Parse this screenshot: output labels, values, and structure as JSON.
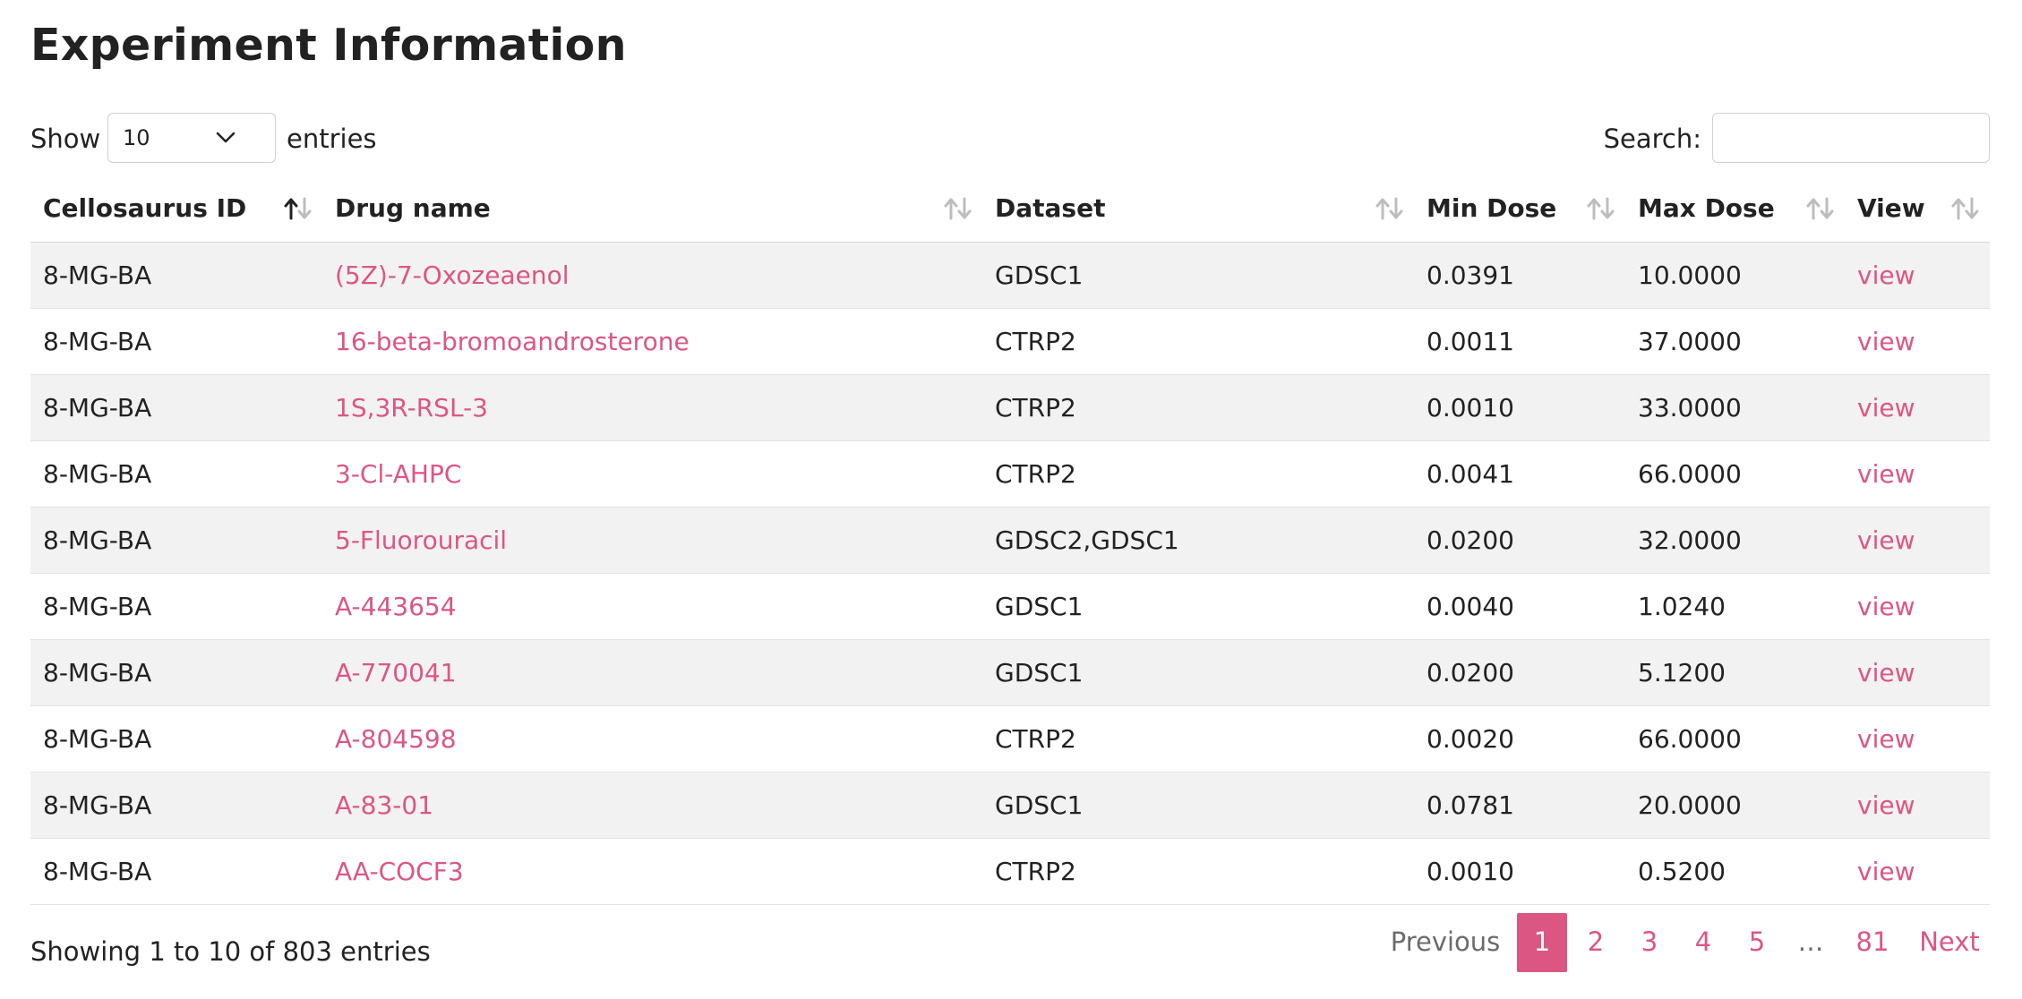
{
  "page": {
    "title": "Experiment Information"
  },
  "length_control": {
    "label": "Show",
    "value": "10",
    "suffix": "entries"
  },
  "search": {
    "label": "Search:",
    "value": "",
    "placeholder": ""
  },
  "table": {
    "headers": [
      "Cellosaurus ID",
      "Drug name",
      "Dataset",
      "Min Dose",
      "Max Dose",
      "View"
    ],
    "sorted_column": "Cellosaurus ID",
    "sort_direction": "ascending",
    "rows": [
      [
        "8-MG-BA",
        "(5Z)-7-Oxozeaenol",
        "GDSC1",
        "0.0391",
        "10.0000",
        "view"
      ],
      [
        "8-MG-BA",
        "16-beta-bromoandrosterone",
        "CTRP2",
        "0.0011",
        "37.0000",
        "view"
      ],
      [
        "8-MG-BA",
        "1S,3R-RSL-3",
        "CTRP2",
        "0.0010",
        "33.0000",
        "view"
      ],
      [
        "8-MG-BA",
        "3-Cl-AHPC",
        "CTRP2",
        "0.0041",
        "66.0000",
        "view"
      ],
      [
        "8-MG-BA",
        "5-Fluorouracil",
        "GDSC2,GDSC1",
        "0.0200",
        "32.0000",
        "view"
      ],
      [
        "8-MG-BA",
        "A-443654",
        "GDSC1",
        "0.0040",
        "1.0240",
        "view"
      ],
      [
        "8-MG-BA",
        "A-770041",
        "GDSC1",
        "0.0200",
        "5.1200",
        "view"
      ],
      [
        "8-MG-BA",
        "A-804598",
        "CTRP2",
        "0.0020",
        "66.0000",
        "view"
      ],
      [
        "8-MG-BA",
        "A-83-01",
        "GDSC1",
        "0.0781",
        "20.0000",
        "view"
      ],
      [
        "8-MG-BA",
        "AA-COCF3",
        "CTRP2",
        "0.0010",
        "0.5200",
        "view"
      ]
    ]
  },
  "info": "Showing 1 to 10 of 803 entries",
  "pagination": {
    "previous": "Previous",
    "pages": [
      "1",
      "2",
      "3",
      "4",
      "5"
    ],
    "ellipsis": "…",
    "last": "81",
    "next": "Next",
    "current": "1"
  },
  "colors": {
    "link": "#dc5683",
    "active_page_bg": "#dc5683",
    "stripe": "#f2f2f2",
    "heading": "#222222"
  }
}
